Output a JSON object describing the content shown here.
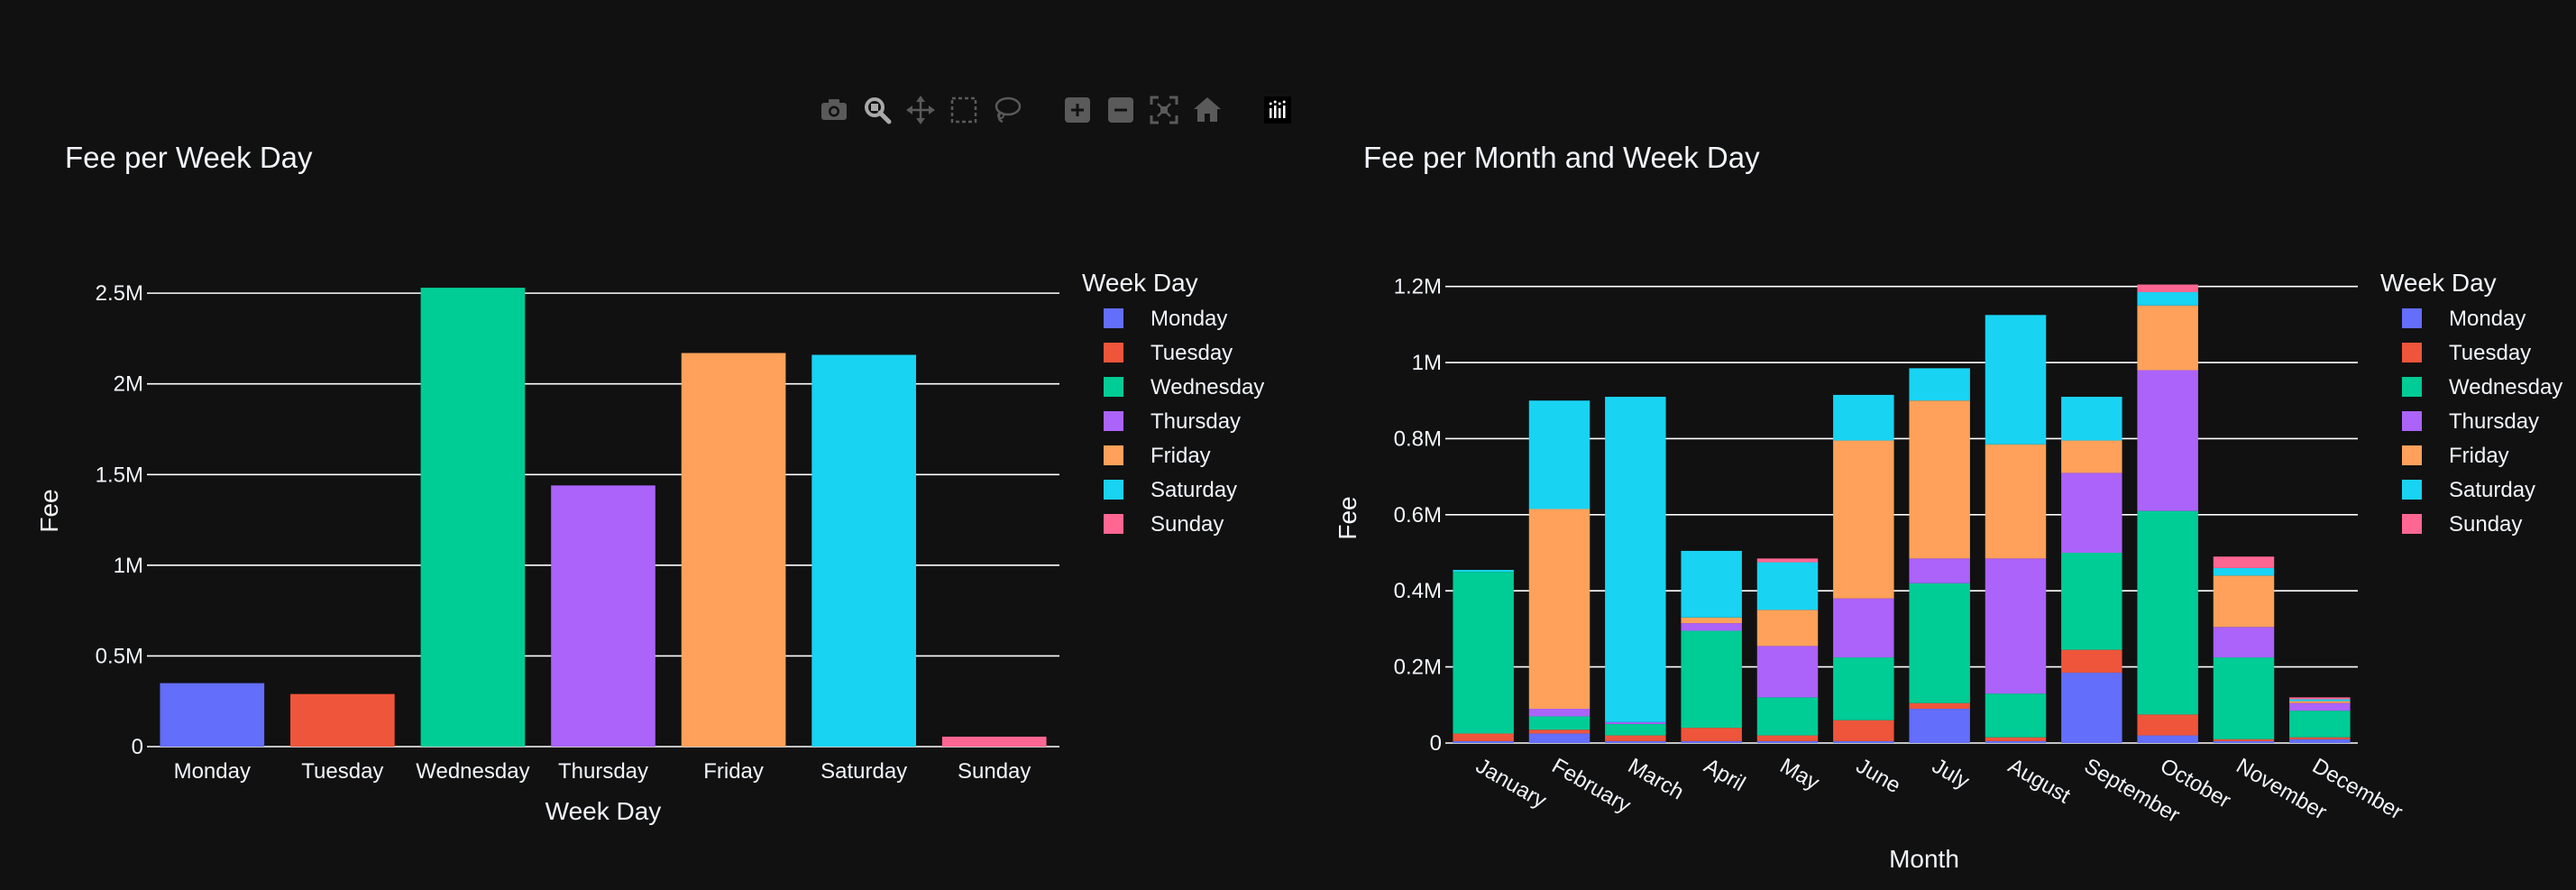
{
  "colors": {
    "background": "#111111",
    "text": "#f2f5fa",
    "grid": "#ffffff",
    "toolbar_icon": "#5a5a5a",
    "toolbar_active": "#a9a9a9",
    "monday": "#636efa",
    "tuesday": "#ef553b",
    "wednesday": "#00cc96",
    "thursday": "#ab63fa",
    "friday": "#ffa15a",
    "saturday": "#19d3f3",
    "sunday": "#ff6692"
  },
  "toolbar": {
    "icons": [
      "camera-icon",
      "zoom-icon",
      "pan-icon",
      "box-select-icon",
      "lasso-select-icon",
      "zoom-in-icon",
      "zoom-out-icon",
      "autoscale-icon",
      "reset-axes-icon",
      "plotly-logo-icon"
    ]
  },
  "chart_data": [
    {
      "type": "bar",
      "title": "Fee per Week Day",
      "xlabel": "Week Day",
      "ylabel": "Fee",
      "ylim": [
        0,
        2600000
      ],
      "yticks": [
        0,
        500000,
        1000000,
        1500000,
        2000000,
        2500000
      ],
      "ytick_labels": [
        "0",
        "0.5M",
        "1M",
        "1.5M",
        "2M",
        "2.5M"
      ],
      "grid": true,
      "legend": {
        "title": "Week Day",
        "placement": "right"
      },
      "categories": [
        "Monday",
        "Tuesday",
        "Wednesday",
        "Thursday",
        "Friday",
        "Saturday",
        "Sunday"
      ],
      "values": [
        350000,
        290000,
        2530000,
        1440000,
        2170000,
        2160000,
        55000
      ]
    },
    {
      "type": "bar",
      "stacked": true,
      "title": "Fee per Month and Week Day",
      "xlabel": "Month",
      "ylabel": "Fee",
      "ylim": [
        0,
        1230000
      ],
      "yticks": [
        0,
        200000,
        400000,
        600000,
        800000,
        1000000,
        1200000
      ],
      "ytick_labels": [
        "0",
        "0.2M",
        "0.4M",
        "0.6M",
        "0.8M",
        "1M",
        "1.2M"
      ],
      "grid": true,
      "legend": {
        "title": "Week Day",
        "placement": "right"
      },
      "categories": [
        "January",
        "February",
        "March",
        "April",
        "May",
        "June",
        "July",
        "August",
        "September",
        "October",
        "November",
        "December"
      ],
      "series": [
        {
          "name": "Monday",
          "values": [
            5000,
            25000,
            5000,
            5000,
            5000,
            5000,
            90000,
            5000,
            185000,
            20000,
            5000,
            10000
          ]
        },
        {
          "name": "Tuesday",
          "values": [
            20000,
            10000,
            15000,
            35000,
            15000,
            55000,
            15000,
            10000,
            60000,
            55000,
            5000,
            5000
          ]
        },
        {
          "name": "Wednesday",
          "values": [
            425000,
            35000,
            30000,
            255000,
            100000,
            165000,
            315000,
            115000,
            255000,
            535000,
            215000,
            70000
          ]
        },
        {
          "name": "Thursday",
          "values": [
            0,
            20000,
            5000,
            20000,
            135000,
            155000,
            65000,
            355000,
            210000,
            370000,
            80000,
            20000
          ]
        },
        {
          "name": "Friday",
          "values": [
            0,
            525000,
            0,
            15000,
            95000,
            415000,
            415000,
            300000,
            85000,
            170000,
            135000,
            5000
          ]
        },
        {
          "name": "Saturday",
          "values": [
            5000,
            285000,
            855000,
            175000,
            125000,
            120000,
            85000,
            340000,
            115000,
            35000,
            20000,
            5000
          ]
        },
        {
          "name": "Sunday",
          "values": [
            0,
            0,
            0,
            0,
            10000,
            0,
            0,
            0,
            0,
            20000,
            30000,
            5000
          ]
        }
      ]
    }
  ]
}
